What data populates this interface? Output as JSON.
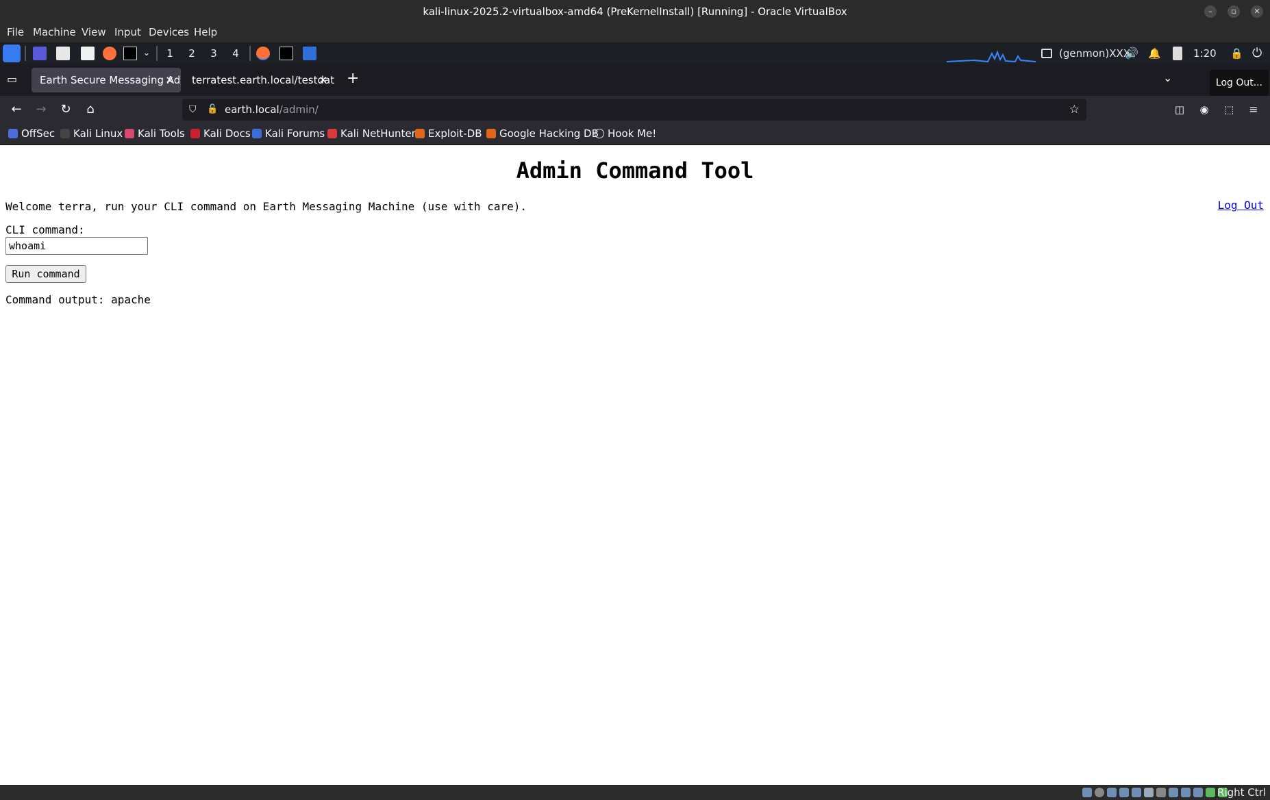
{
  "vbox": {
    "title": "kali-linux-2025.2-virtualbox-amd64 (PreKernelInstall) [Running] - Oracle VirtualBox",
    "menu": [
      "File",
      "Machine",
      "View",
      "Input",
      "Devices",
      "Help"
    ],
    "host_key": "Right Ctrl"
  },
  "panel": {
    "workspaces": [
      "1",
      "2",
      "3",
      "4"
    ],
    "genmon": "(genmon)XXX",
    "clock": "1:20"
  },
  "browser": {
    "tabs": [
      {
        "label": "Earth Secure Messaging Adm",
        "active": true
      },
      {
        "label": "terratest.earth.local/testdata",
        "active": false
      }
    ],
    "url_host": "earth.local",
    "url_path": "/admin/",
    "bookmarks": [
      "OffSec",
      "Kali Linux",
      "Kali Tools",
      "Kali Docs",
      "Kali Forums",
      "Kali NetHunter",
      "Exploit-DB",
      "Google Hacking DB",
      "Hook Me!"
    ]
  },
  "tooltip": "Log Out...",
  "page": {
    "heading": "Admin Command Tool",
    "welcome": "Welcome terra, run your CLI command on Earth Messaging Machine (use with care).",
    "logout_link": "Log Out",
    "cli_label": "CLI command:",
    "cli_value": "whoami",
    "run_button": "Run command",
    "output": "Command output: apache"
  }
}
